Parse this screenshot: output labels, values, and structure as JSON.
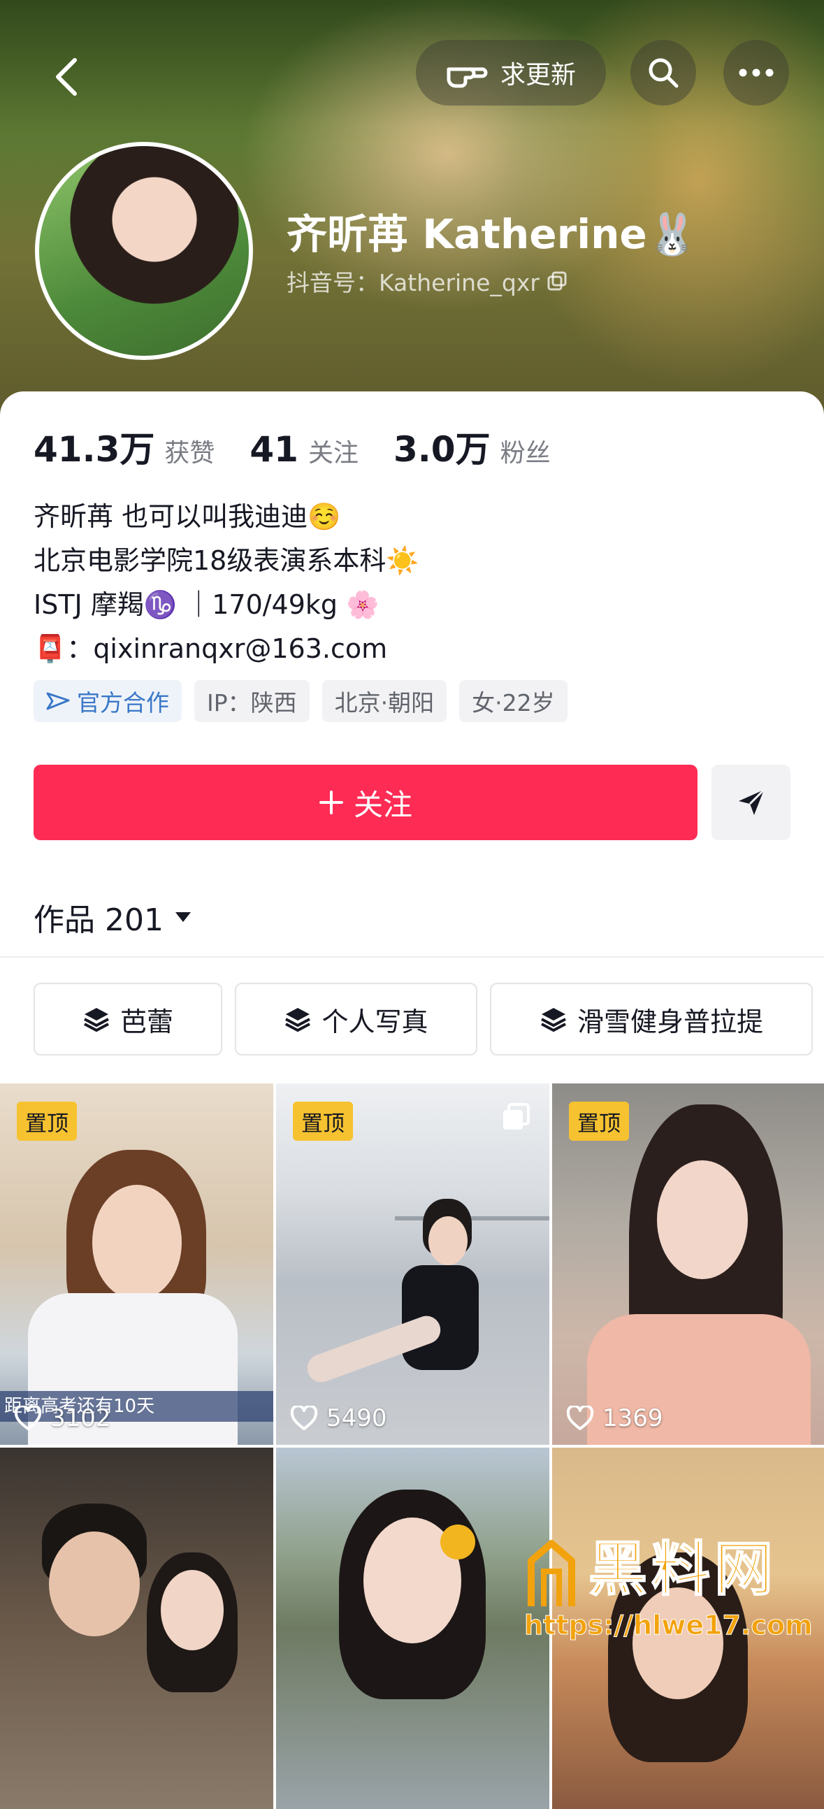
{
  "header": {
    "request_update_label": "求更新",
    "name": "齐昕苒 Katherine🐰",
    "douyin_id": "抖音号：Katherine_qxr"
  },
  "stats": [
    {
      "value": "41.3万",
      "label": "获赞"
    },
    {
      "value": "41",
      "label": "关注"
    },
    {
      "value": "3.0万",
      "label": "粉丝"
    }
  ],
  "bio": [
    "齐昕苒 也可以叫我迪迪☺️",
    "北京电影学院18级表演系本科☀️",
    "ISTJ 摩羯♑️ ｜170/49kg 🌸",
    "📮：qixinranqxr@163.com"
  ],
  "tags": [
    "官方合作",
    "IP：陕西",
    "北京·朝阳",
    "女·22岁"
  ],
  "actions": {
    "follow_label": "关注"
  },
  "works": {
    "label": "作品 201"
  },
  "collections": [
    "芭蕾",
    "个人写真",
    "滑雪健身普拉提"
  ],
  "grid": [
    {
      "pinned": "置顶",
      "likes": "3102",
      "caption": "距离高考还有10天"
    },
    {
      "pinned": "置顶",
      "likes": "5490"
    },
    {
      "pinned": "置顶",
      "likes": "1369"
    },
    {},
    {},
    {}
  ],
  "watermark": {
    "brand": "黑料网",
    "url": "https://hlwe17.com"
  },
  "colors": {
    "accent": "#fe2c55",
    "pin": "#f6c230"
  }
}
